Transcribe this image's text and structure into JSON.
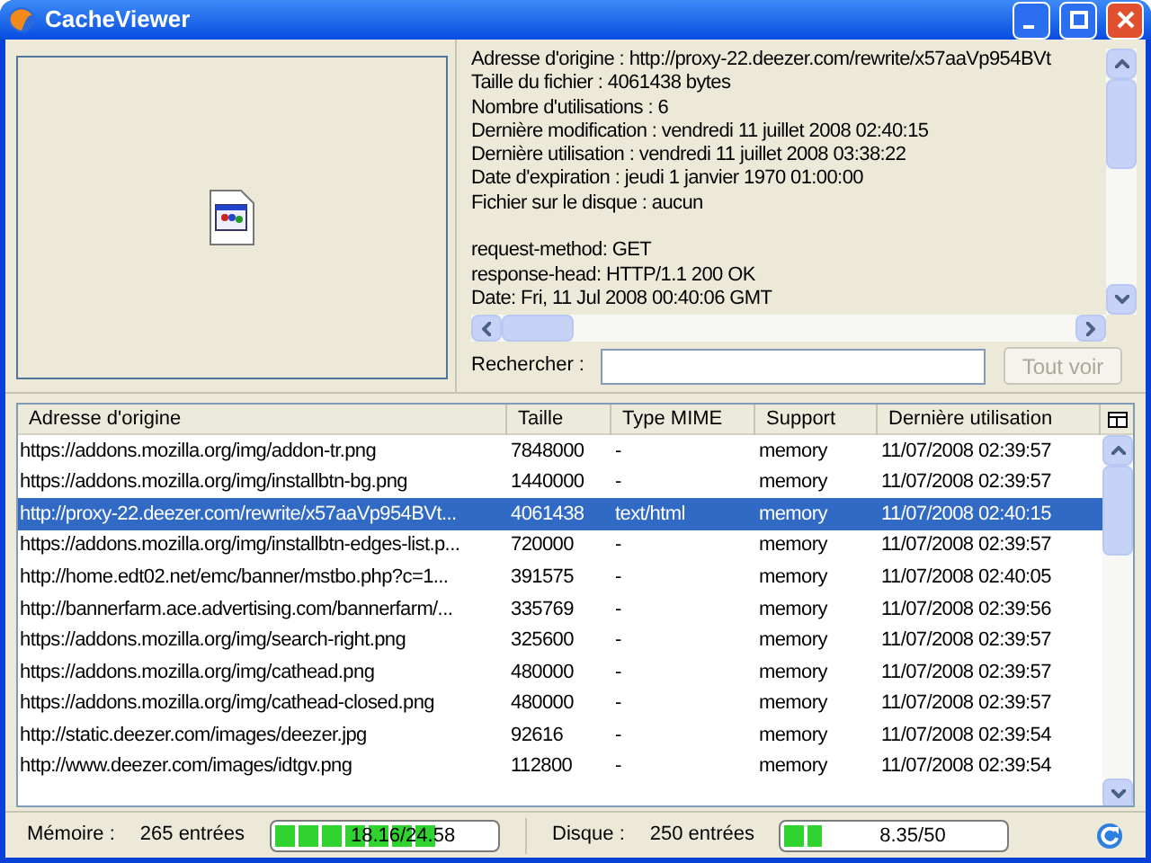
{
  "window": {
    "title": "CacheViewer"
  },
  "details": {
    "lines": [
      "Adresse d'origine : http://proxy-22.deezer.com/rewrite/x57aaVp954BVt",
      "Taille du fichier : 4061438 bytes",
      "Nombre d'utilisations : 6",
      "Dernière modification : vendredi 11 juillet 2008 02:40:15",
      "Dernière utilisation : vendredi 11 juillet 2008 03:38:22",
      "Date d'expiration : jeudi 1 janvier 1970 01:00:00",
      "Fichier sur le disque : aucun"
    ],
    "headers": [
      "request-method: GET",
      "response-head: HTTP/1.1 200 OK",
      "Date: Fri, 11 Jul 2008 00:40:06 GMT"
    ]
  },
  "search": {
    "label": "Rechercher :",
    "button": {
      "label": "Tout voir",
      "disabled": true
    }
  },
  "table": {
    "columns": [
      "Adresse d'origine",
      "Taille",
      "Type MIME",
      "Support",
      "Dernière utilisation"
    ],
    "rows": [
      {
        "cells": [
          "https://addons.mozilla.org/img/addon-tr.png",
          "7848000",
          "-",
          "memory",
          "11/07/2008 02:39:57"
        ],
        "selected": false
      },
      {
        "cells": [
          "https://addons.mozilla.org/img/installbtn-bg.png",
          "1440000",
          "-",
          "memory",
          "11/07/2008 02:39:57"
        ],
        "selected": false
      },
      {
        "cells": [
          "http://proxy-22.deezer.com/rewrite/x57aaVp954BVt...",
          "4061438",
          "text/html",
          "memory",
          "11/07/2008 02:40:15"
        ],
        "selected": true
      },
      {
        "cells": [
          "https://addons.mozilla.org/img/installbtn-edges-list.p...",
          "720000",
          "-",
          "memory",
          "11/07/2008 02:39:57"
        ],
        "selected": false
      },
      {
        "cells": [
          "http://home.edt02.net/emc/banner/mstbo.php?c=1...",
          "391575",
          "-",
          "memory",
          "11/07/2008 02:40:05"
        ],
        "selected": false
      },
      {
        "cells": [
          "http://bannerfarm.ace.advertising.com/bannerfarm/...",
          "335769",
          "-",
          "memory",
          "11/07/2008 02:39:56"
        ],
        "selected": false
      },
      {
        "cells": [
          "https://addons.mozilla.org/img/search-right.png",
          "325600",
          "-",
          "memory",
          "11/07/2008 02:39:57"
        ],
        "selected": false
      },
      {
        "cells": [
          "https://addons.mozilla.org/img/cathead.png",
          "480000",
          "-",
          "memory",
          "11/07/2008 02:39:57"
        ],
        "selected": false
      },
      {
        "cells": [
          "https://addons.mozilla.org/img/cathead-closed.png",
          "480000",
          "-",
          "memory",
          "11/07/2008 02:39:57"
        ],
        "selected": false
      },
      {
        "cells": [
          "http://static.deezer.com/images/deezer.jpg",
          "92616",
          "-",
          "memory",
          "11/07/2008 02:39:54"
        ],
        "selected": false
      },
      {
        "cells": [
          "http://www.deezer.com/images/idtgv.png",
          "112800",
          "-",
          "memory",
          "11/07/2008 02:39:54"
        ],
        "selected": false
      }
    ]
  },
  "status_bar": {
    "memory": {
      "label": "Mémoire :",
      "entries": "265 entrées",
      "reading": "18.16/24.58",
      "level": 0.74
    },
    "disk": {
      "label": "Disque :",
      "entries": "250 entrées",
      "reading": "8.35/50",
      "level": 0.17
    }
  }
}
